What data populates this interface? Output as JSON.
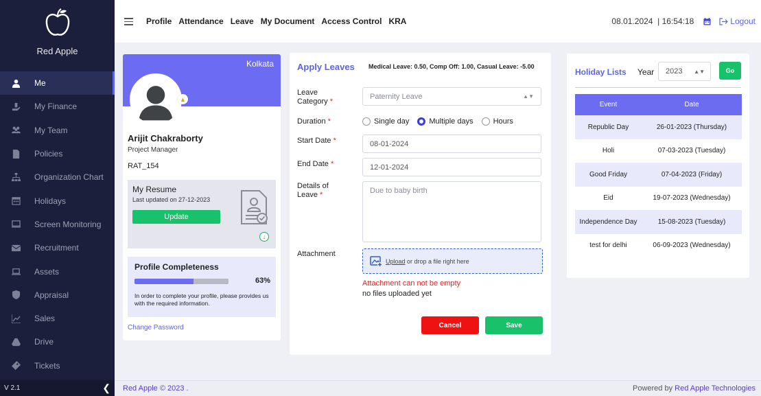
{
  "brand": {
    "name": "Red Apple"
  },
  "sidebar": {
    "items": [
      {
        "label": "Me",
        "icon": "user-icon",
        "active": true
      },
      {
        "label": "My Finance",
        "icon": "finance-icon"
      },
      {
        "label": "My Team",
        "icon": "team-icon"
      },
      {
        "label": "Policies",
        "icon": "document-icon"
      },
      {
        "label": "Organization Chart",
        "icon": "org-chart-icon"
      },
      {
        "label": "Holidays",
        "icon": "calendar-icon"
      },
      {
        "label": "Screen Monitoring",
        "icon": "monitor-icon"
      },
      {
        "label": "Recruitment",
        "icon": "envelope-icon"
      },
      {
        "label": "Assets",
        "icon": "laptop-icon"
      },
      {
        "label": "Appraisal",
        "icon": "shield-icon"
      },
      {
        "label": "Sales",
        "icon": "line-chart-icon"
      },
      {
        "label": "Drive",
        "icon": "drive-icon"
      },
      {
        "label": "Tickets",
        "icon": "ticket-icon"
      }
    ],
    "version": "V 2.1"
  },
  "topbar": {
    "nav": [
      "Profile",
      "Attendance",
      "Leave",
      "My Document",
      "Access Control",
      "KRA"
    ],
    "datetime": "08.01.2024  | 16:54:18",
    "logout": "Logout"
  },
  "profile": {
    "location": "Kolkata",
    "name": "Arijit Chakraborty",
    "designation": "Project Manager",
    "code": "RAT_154",
    "resume": {
      "title": "My Resume",
      "updated": "Last updated on 27-12-2023",
      "update_label": "Update"
    },
    "completeness": {
      "title": "Profile Completeness",
      "percent": 63,
      "percent_label": "63%",
      "description": "In order to complete your profile, please provides us with the required information."
    },
    "change_password": "Change Password"
  },
  "leave": {
    "title": "Apply Leaves",
    "balance": "Medical Leave: 0.50, Comp Off: 1.00, Casual Leave: -5.00",
    "labels": {
      "category": "Leave Category",
      "duration": "Duration",
      "start": "Start Date",
      "end": "End Date",
      "details": "Details of Leave",
      "attachment": "Attachment"
    },
    "required_mark": "*",
    "category_value": "Paternity Leave",
    "duration_options": [
      "Single day",
      "Multiple days",
      "Hours"
    ],
    "duration_selected": "Multiple days",
    "start_date": "08-01-2024",
    "end_date": "12-01-2024",
    "details_placeholder": "Due to baby birth",
    "upload_link": "Upload",
    "upload_text": " or drop a file right here",
    "attachment_error": "Attachment can not be empty",
    "no_files": "no files uploaded yet",
    "cancel_label": "Cancel",
    "save_label": "Save"
  },
  "holidays": {
    "title": "Holiday Lists",
    "year_label": "Year",
    "year": "2023",
    "go_label": "Go",
    "columns": [
      "Event",
      "Date"
    ],
    "rows": [
      {
        "event": "Republic Day",
        "date": "26-01-2023 (Thursday)"
      },
      {
        "event": "Holi",
        "date": "07-03-2023 (Tuesday)"
      },
      {
        "event": "Good Friday",
        "date": "07-04-2023 (Friday)"
      },
      {
        "event": "Eid",
        "date": "19-07-2023 (Wednesday)"
      },
      {
        "event": "Independence Day",
        "date": "15-08-2023 (Tuesday)"
      },
      {
        "event": "test for delhi",
        "date": "06-09-2023 (Wednesday)"
      }
    ]
  },
  "footer": {
    "left": "Red Apple © 2023 .",
    "powered": "Powered by ",
    "company": "Red Apple Technologies"
  },
  "colors": {
    "accent": "#6c6cf2",
    "sidebar": "#1b1f3b",
    "success": "#19c16b",
    "danger": "#ee1212"
  }
}
